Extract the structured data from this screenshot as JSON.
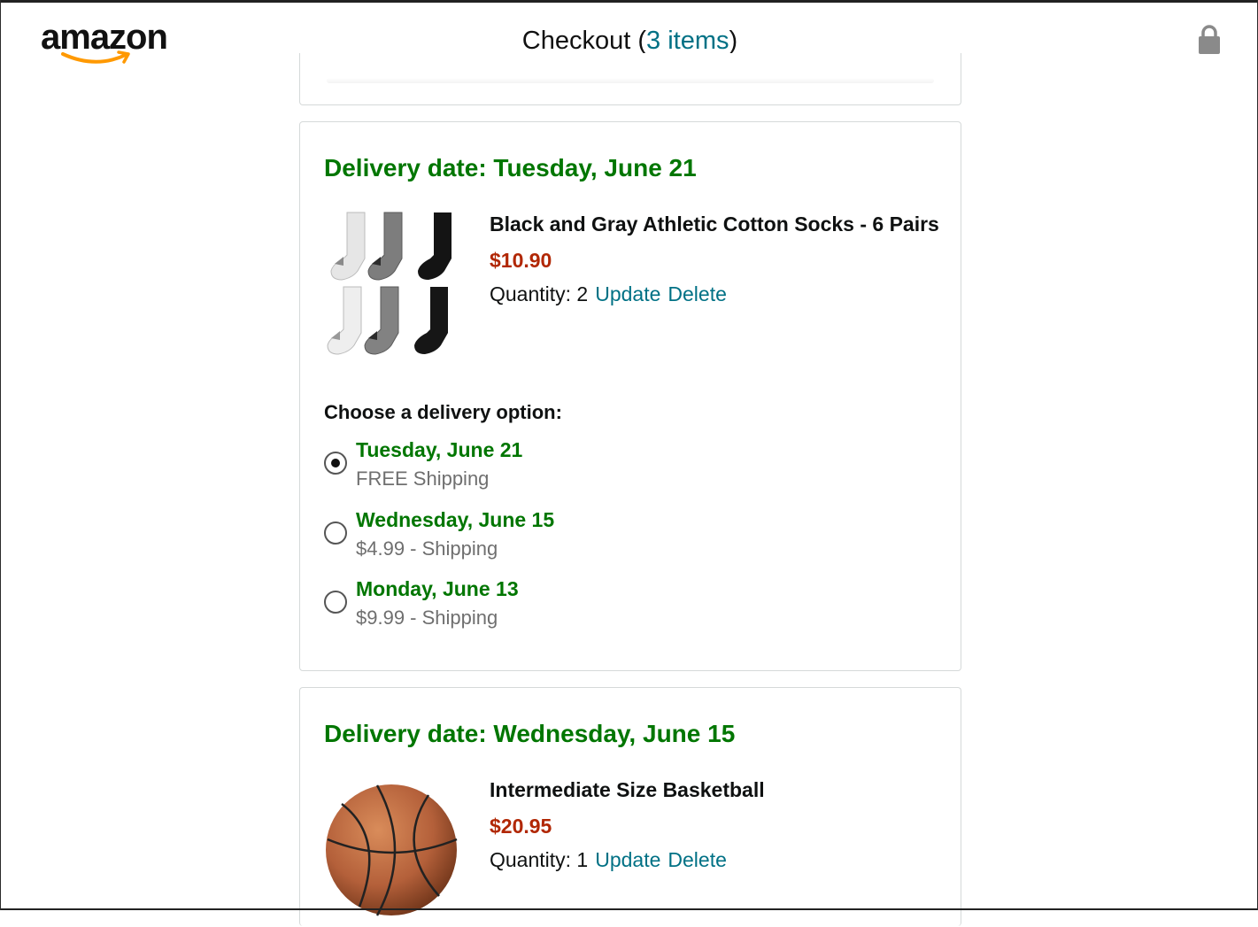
{
  "header": {
    "logo_text": "amazon",
    "title_prefix": "Checkout (",
    "items_link": "3 items",
    "title_suffix": ")"
  },
  "orders": [
    {
      "delivery_date": "Delivery date: Tuesday, June 21",
      "product_name": "Black and Gray Athletic Cotton Socks - 6 Pairs",
      "price": "$10.90",
      "quantity_label": "Quantity: 2",
      "update_label": "Update",
      "delete_label": "Delete",
      "choose_label": "Choose a delivery option:",
      "options": [
        {
          "date": "Tuesday, June 21",
          "shipping": "FREE Shipping",
          "selected": true
        },
        {
          "date": "Wednesday, June 15",
          "shipping": "$4.99 - Shipping",
          "selected": false
        },
        {
          "date": "Monday, June 13",
          "shipping": "$9.99 - Shipping",
          "selected": false
        }
      ]
    },
    {
      "delivery_date": "Delivery date: Wednesday, June 15",
      "product_name": "Intermediate Size Basketball",
      "price": "$20.95",
      "quantity_label": "Quantity: 1",
      "update_label": "Update",
      "delete_label": "Delete"
    }
  ],
  "colors": {
    "delivery_green": "#007600",
    "price_red": "#b12704",
    "link_teal": "#007185",
    "logo_smile": "#ff9900"
  },
  "icons": [
    "amazon-smile-logo",
    "lock-icon",
    "radio-button"
  ]
}
